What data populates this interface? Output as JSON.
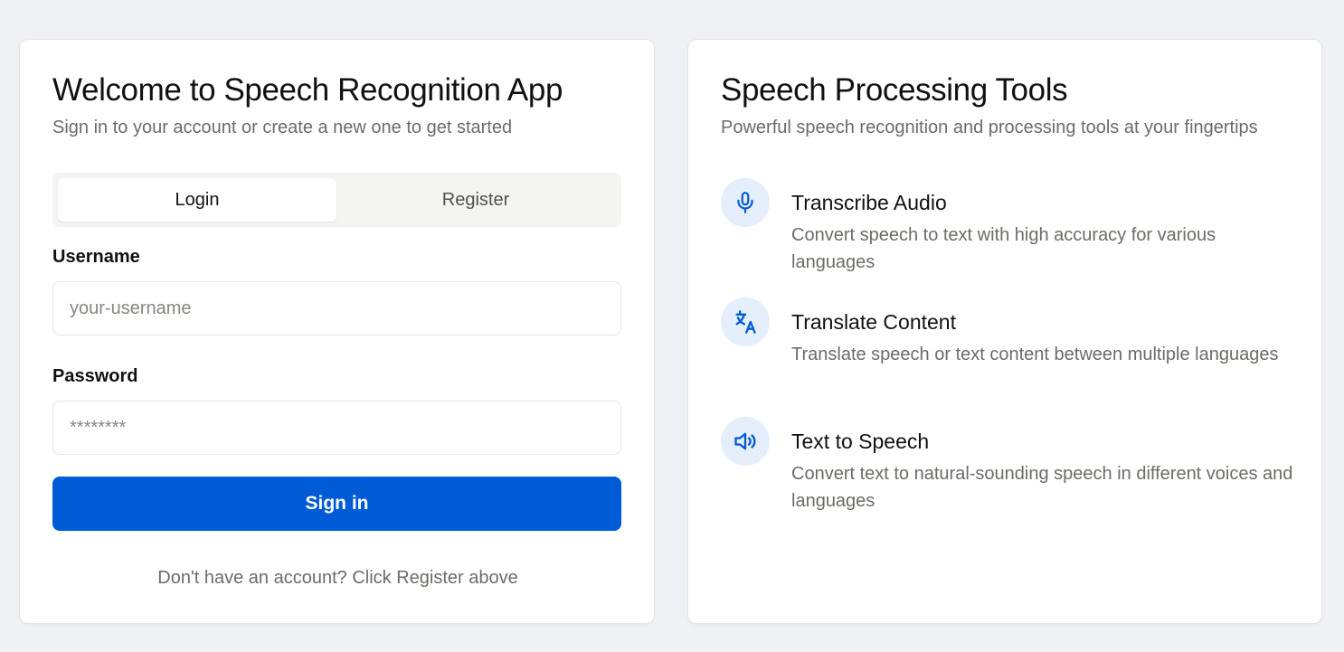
{
  "login_card": {
    "title": "Welcome to Speech Recognition App",
    "subtitle": "Sign in to your account or create a new one to get started",
    "tabs": [
      {
        "label": "Login",
        "active": true
      },
      {
        "label": "Register",
        "active": false
      }
    ],
    "username": {
      "label": "Username",
      "placeholder": "your-username",
      "value": ""
    },
    "password": {
      "label": "Password",
      "placeholder": "********",
      "value": ""
    },
    "submit_label": "Sign in",
    "footer_note": "Don't have an account? Click Register above"
  },
  "tools_card": {
    "title": "Speech Processing Tools",
    "subtitle": "Powerful speech recognition and processing tools at your fingertips",
    "features": [
      {
        "icon": "microphone-icon",
        "title": "Transcribe Audio",
        "description": "Convert speech to text with high accuracy for various languages"
      },
      {
        "icon": "translate-icon",
        "title": "Translate Content",
        "description": "Translate speech or text content between multiple languages"
      },
      {
        "icon": "speaker-icon",
        "title": "Text to Speech",
        "description": "Convert text to natural-sounding speech in different voices and languages"
      }
    ]
  },
  "colors": {
    "accent": "#005bd6",
    "icon_bg": "#e5eefb",
    "page_bg": "#f0f1f5",
    "muted_text": "#6f6a66"
  }
}
